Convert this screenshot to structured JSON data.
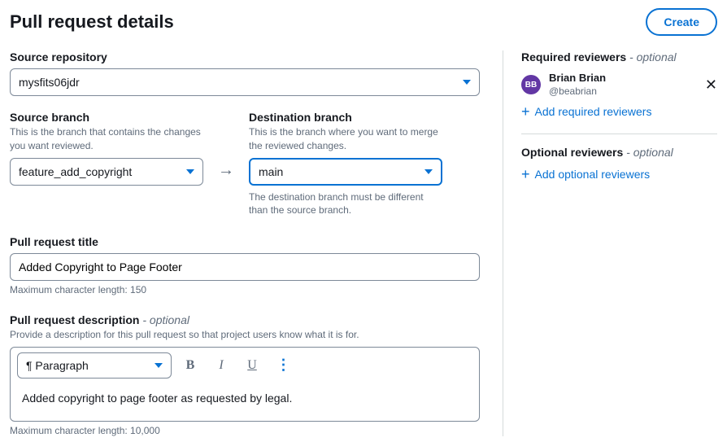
{
  "header": {
    "title": "Pull request details",
    "create_button": "Create"
  },
  "repository": {
    "label": "Source repository",
    "value": "mysfits06jdr"
  },
  "source_branch": {
    "label": "Source branch",
    "hint": "This is the branch that contains the changes you want reviewed.",
    "value": "feature_add_copyright"
  },
  "dest_branch": {
    "label": "Destination branch",
    "hint": "This is the branch where you want to merge the reviewed changes.",
    "value": "main",
    "note": "The destination branch must be different than the source branch."
  },
  "pr_title": {
    "label": "Pull request title",
    "value": "Added Copyright to Page Footer",
    "limit": "Maximum character length: 150"
  },
  "pr_description": {
    "label": "Pull request description",
    "optional": " - optional",
    "hint": "Provide a description for this pull request so that project users know what it is for.",
    "format_label": "¶ Paragraph",
    "body": "Added copyright to page footer as requested by legal.",
    "limit": "Maximum character length: 10,000"
  },
  "required_reviewers": {
    "label": "Required reviewers",
    "optional": " - optional",
    "reviewer": {
      "initials": "BB",
      "name": "Brian Brian",
      "handle": "@beabrian"
    },
    "add_link": "Add required reviewers"
  },
  "optional_reviewers": {
    "label": "Optional reviewers",
    "optional": " - optional",
    "add_link": "Add optional reviewers"
  }
}
